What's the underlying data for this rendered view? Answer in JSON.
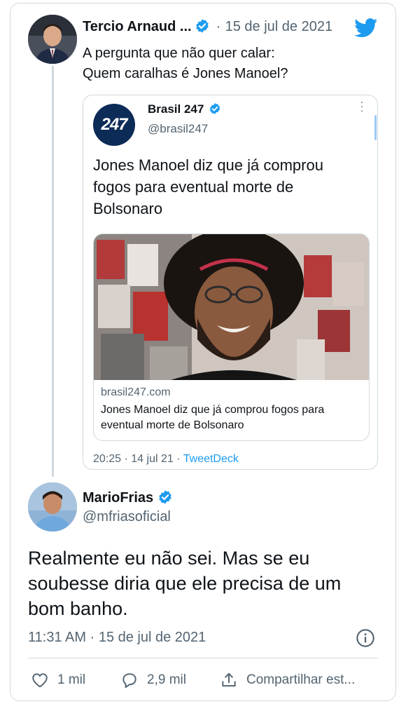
{
  "parent": {
    "display_name": "Tercio Arnaud ...",
    "separator": "·",
    "date": "15 de jul de 2021",
    "text_line1": "A pergunta que não quer calar:",
    "text_line2": "Quem caralhas é Jones Manoel?"
  },
  "quoted": {
    "avatar_text": "247",
    "display_name": "Brasil 247",
    "handle": "@brasil247",
    "text_line1": "Jones Manoel diz que já comprou",
    "text_line2": "fogos para eventual morte de",
    "text_line3": "Bolsonaro",
    "link_domain": "brasil247.com",
    "link_title_line1": "Jones Manoel diz que já comprou fogos para",
    "link_title_line2": "eventual morte de Bolsonaro",
    "time": "20:25",
    "sep": "·",
    "date": "14 jul 21",
    "sep2": "·",
    "source": "TweetDeck"
  },
  "reply": {
    "display_name": "MarioFrias",
    "handle": "@mfriasoficial",
    "text_line1": "Realmente eu não sei. Mas se eu",
    "text_line2": "soubesse diria que ele precisa de um",
    "text_line3": "bom banho.",
    "time": "11:31 AM",
    "sep": "·",
    "date": "15 de jul de 2021",
    "likes": "1 mil",
    "replies": "2,9 mil",
    "share_label": "Compartilhar est..."
  },
  "colors": {
    "accent": "#1d9bf0",
    "muted": "#536471",
    "border": "#cfd9de"
  },
  "icons": [
    "verified-badge-icon",
    "twitter-bird-icon",
    "more-options-icon",
    "info-icon",
    "heart-icon",
    "reply-bubble-icon",
    "share-icon"
  ]
}
